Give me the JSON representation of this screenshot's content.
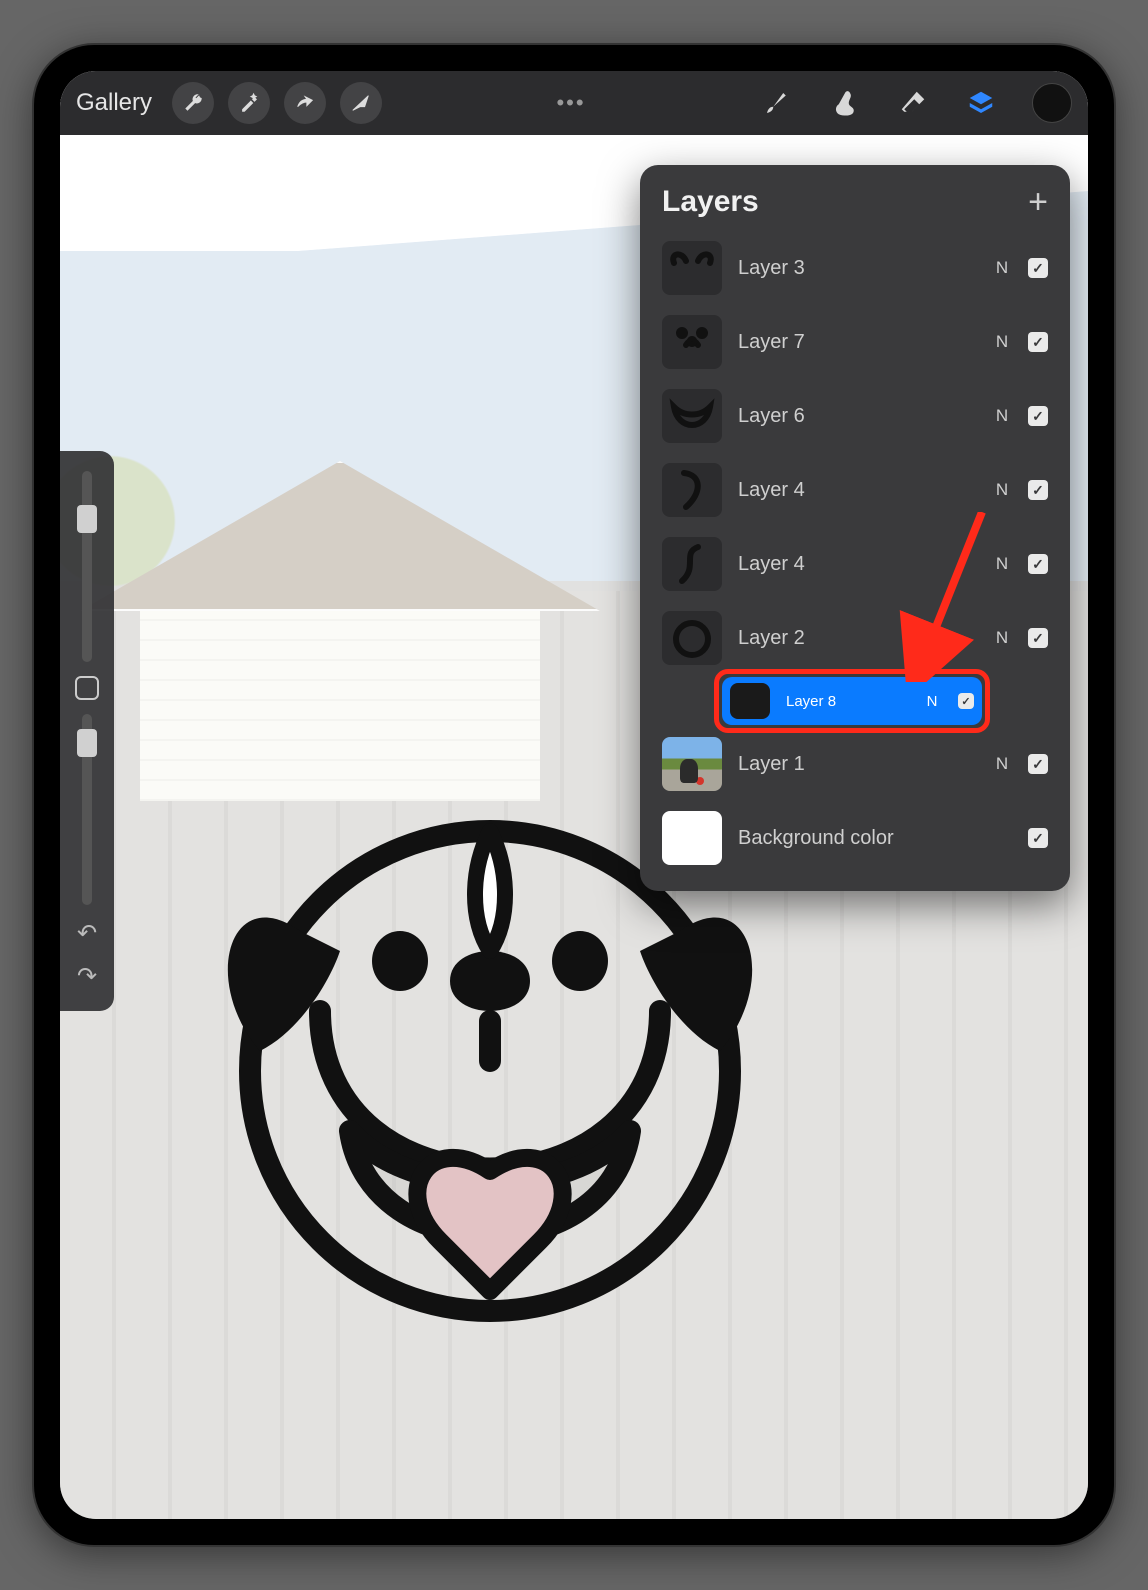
{
  "toolbar": {
    "gallery_label": "Gallery",
    "buttons": {
      "wrench": "wrench-icon",
      "wand": "wand-icon",
      "select": "select-icon",
      "move": "move-icon",
      "more": "•••",
      "brush": "brush-icon",
      "smudge": "smudge-icon",
      "eraser": "eraser-icon",
      "layers": "layers-icon",
      "color": "#111111"
    }
  },
  "side": {
    "brush_slider_pos_pct": 18,
    "opacity_slider_pos_pct": 8
  },
  "layers_panel": {
    "title": "Layers",
    "add_label": "+",
    "items": [
      {
        "label": "Layer 3",
        "blend": "N",
        "visible": true,
        "thumb": "ears"
      },
      {
        "label": "Layer 7",
        "blend": "N",
        "visible": true,
        "thumb": "nose"
      },
      {
        "label": "Layer 6",
        "blend": "N",
        "visible": true,
        "thumb": "mouth"
      },
      {
        "label": "Layer 4",
        "blend": "N",
        "visible": true,
        "thumb": "curve1"
      },
      {
        "label": "Layer 4",
        "blend": "N",
        "visible": true,
        "thumb": "curve2"
      },
      {
        "label": "Layer 2",
        "blend": "N",
        "visible": true,
        "thumb": "circle"
      },
      {
        "label": "Layer 8",
        "blend": "N",
        "visible": true,
        "thumb": "dark",
        "selected": true,
        "highlighted": true
      },
      {
        "label": "Layer 1",
        "blend": "N",
        "visible": true,
        "thumb": "photo"
      },
      {
        "label": "Background color",
        "blend": "",
        "visible": true,
        "thumb": "white",
        "is_bg": true
      }
    ]
  },
  "annotation": {
    "arrow_target": "Layer 8"
  }
}
